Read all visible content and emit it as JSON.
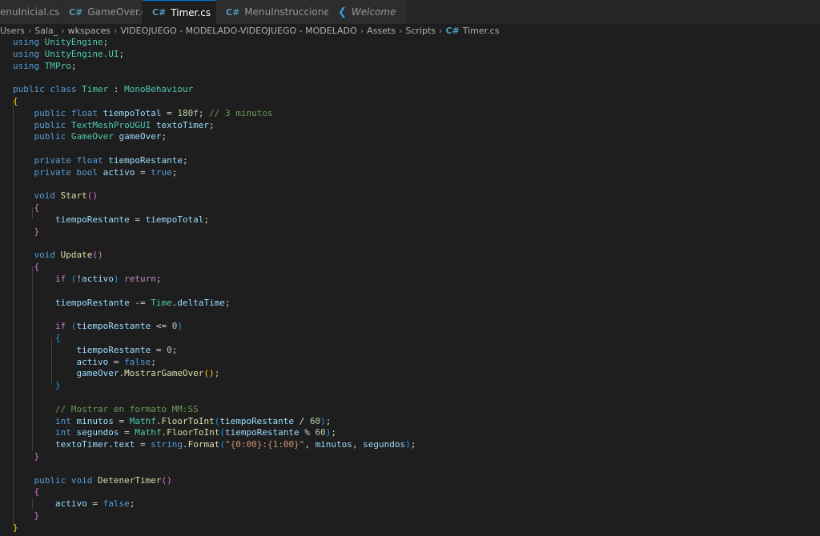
{
  "tabs": [
    {
      "label": "enuInicial.cs",
      "icon": "csharp-icon",
      "active": false
    },
    {
      "label": "GameOver.cs",
      "icon": "csharp-icon",
      "active": false
    },
    {
      "label": "Timer.cs",
      "icon": "csharp-icon",
      "active": true,
      "modified": true
    },
    {
      "label": "MenuInstrucciones.cs",
      "icon": "csharp-icon",
      "active": false
    },
    {
      "label": "Welcome",
      "icon": "vscode-icon",
      "active": false
    }
  ],
  "breadcrumb": [
    "Users",
    "Sala_",
    "wkspaces",
    "VIDEOJUEGO - MODELADO-VIDEOJUEGO - MODELADO",
    "Assets",
    "Scripts",
    "Timer.cs"
  ],
  "code": [
    [
      {
        "t": "using ",
        "c": "kw"
      },
      {
        "t": "UnityEngine",
        "c": "type"
      },
      {
        "t": ";"
      }
    ],
    [
      {
        "t": "using ",
        "c": "kw"
      },
      {
        "t": "UnityEngine.UI",
        "c": "type"
      },
      {
        "t": ";"
      }
    ],
    [
      {
        "t": "using ",
        "c": "kw"
      },
      {
        "t": "TMPro",
        "c": "type"
      },
      {
        "t": ";"
      }
    ],
    [],
    [
      {
        "t": "public ",
        "c": "kw"
      },
      {
        "t": "class ",
        "c": "kw"
      },
      {
        "t": "Timer",
        "c": "type"
      },
      {
        "t": " : "
      },
      {
        "t": "MonoBehaviour",
        "c": "type"
      }
    ],
    [
      {
        "t": "{",
        "c": "br1"
      }
    ],
    [
      {
        "t": "    "
      },
      {
        "t": "public ",
        "c": "kw"
      },
      {
        "t": "float ",
        "c": "kw"
      },
      {
        "t": "tiempoTotal",
        "c": "var"
      },
      {
        "t": " = "
      },
      {
        "t": "180f",
        "c": "num"
      },
      {
        "t": "; "
      },
      {
        "t": "// 3 minutos",
        "c": "com"
      }
    ],
    [
      {
        "t": "    "
      },
      {
        "t": "public ",
        "c": "kw"
      },
      {
        "t": "TextMeshProUGUI",
        "c": "type"
      },
      {
        "t": " "
      },
      {
        "t": "textoTimer",
        "c": "var"
      },
      {
        "t": ";"
      }
    ],
    [
      {
        "t": "    "
      },
      {
        "t": "public ",
        "c": "kw"
      },
      {
        "t": "GameOver",
        "c": "type"
      },
      {
        "t": " "
      },
      {
        "t": "gameOver",
        "c": "var"
      },
      {
        "t": ";"
      }
    ],
    [],
    [
      {
        "t": "    "
      },
      {
        "t": "private ",
        "c": "kw"
      },
      {
        "t": "float ",
        "c": "kw"
      },
      {
        "t": "tiempoRestante",
        "c": "var"
      },
      {
        "t": ";"
      }
    ],
    [
      {
        "t": "    "
      },
      {
        "t": "private ",
        "c": "kw"
      },
      {
        "t": "bool ",
        "c": "kw"
      },
      {
        "t": "activo",
        "c": "var"
      },
      {
        "t": " = "
      },
      {
        "t": "true",
        "c": "kw"
      },
      {
        "t": ";"
      }
    ],
    [],
    [
      {
        "t": "    "
      },
      {
        "t": "void ",
        "c": "kw"
      },
      {
        "t": "Start",
        "c": "fn"
      },
      {
        "t": "()",
        "c": "br2"
      }
    ],
    [
      {
        "t": "    "
      },
      {
        "t": "{",
        "c": "br2"
      }
    ],
    [
      {
        "t": "        "
      },
      {
        "t": "tiempoRestante",
        "c": "var"
      },
      {
        "t": " = "
      },
      {
        "t": "tiempoTotal",
        "c": "var"
      },
      {
        "t": ";"
      }
    ],
    [
      {
        "t": "    "
      },
      {
        "t": "}",
        "c": "br2"
      }
    ],
    [],
    [
      {
        "t": "    "
      },
      {
        "t": "void ",
        "c": "kw"
      },
      {
        "t": "Update",
        "c": "fn"
      },
      {
        "t": "()",
        "c": "br2"
      }
    ],
    [
      {
        "t": "    "
      },
      {
        "t": "{",
        "c": "br2"
      }
    ],
    [
      {
        "t": "        "
      },
      {
        "t": "if ",
        "c": "ctrl"
      },
      {
        "t": "(",
        "c": "br3"
      },
      {
        "t": "!"
      },
      {
        "t": "activo",
        "c": "var"
      },
      {
        "t": ")",
        "c": "br3"
      },
      {
        "t": " "
      },
      {
        "t": "return",
        "c": "ctrl"
      },
      {
        "t": ";"
      }
    ],
    [],
    [
      {
        "t": "        "
      },
      {
        "t": "tiempoRestante",
        "c": "var"
      },
      {
        "t": " -= "
      },
      {
        "t": "Time",
        "c": "type"
      },
      {
        "t": "."
      },
      {
        "t": "deltaTime",
        "c": "var"
      },
      {
        "t": ";"
      }
    ],
    [],
    [
      {
        "t": "        "
      },
      {
        "t": "if ",
        "c": "ctrl"
      },
      {
        "t": "(",
        "c": "br3"
      },
      {
        "t": "tiempoRestante",
        "c": "var"
      },
      {
        "t": " <= "
      },
      {
        "t": "0",
        "c": "num"
      },
      {
        "t": ")",
        "c": "br3"
      }
    ],
    [
      {
        "t": "        "
      },
      {
        "t": "{",
        "c": "br3"
      }
    ],
    [
      {
        "t": "            "
      },
      {
        "t": "tiempoRestante",
        "c": "var"
      },
      {
        "t": " = "
      },
      {
        "t": "0",
        "c": "num"
      },
      {
        "t": ";"
      }
    ],
    [
      {
        "t": "            "
      },
      {
        "t": "activo",
        "c": "var"
      },
      {
        "t": " = "
      },
      {
        "t": "false",
        "c": "kw"
      },
      {
        "t": ";"
      }
    ],
    [
      {
        "t": "            "
      },
      {
        "t": "gameOver",
        "c": "var"
      },
      {
        "t": "."
      },
      {
        "t": "MostrarGameOver",
        "c": "fn"
      },
      {
        "t": "()",
        "c": "br1"
      },
      {
        "t": ";"
      }
    ],
    [
      {
        "t": "        "
      },
      {
        "t": "}",
        "c": "br3"
      }
    ],
    [],
    [
      {
        "t": "        "
      },
      {
        "t": "// Mostrar en formato MM:SS",
        "c": "com"
      }
    ],
    [
      {
        "t": "        "
      },
      {
        "t": "int ",
        "c": "kw"
      },
      {
        "t": "minutos",
        "c": "var"
      },
      {
        "t": " = "
      },
      {
        "t": "Mathf",
        "c": "type"
      },
      {
        "t": "."
      },
      {
        "t": "FloorToInt",
        "c": "fn"
      },
      {
        "t": "(",
        "c": "br3"
      },
      {
        "t": "tiempoRestante",
        "c": "var"
      },
      {
        "t": " / "
      },
      {
        "t": "60",
        "c": "num"
      },
      {
        "t": ")",
        "c": "br3"
      },
      {
        "t": ";"
      }
    ],
    [
      {
        "t": "        "
      },
      {
        "t": "int ",
        "c": "kw"
      },
      {
        "t": "segundos",
        "c": "var"
      },
      {
        "t": " = "
      },
      {
        "t": "Mathf",
        "c": "type"
      },
      {
        "t": "."
      },
      {
        "t": "FloorToInt",
        "c": "fn"
      },
      {
        "t": "(",
        "c": "br3"
      },
      {
        "t": "tiempoRestante",
        "c": "var"
      },
      {
        "t": " % "
      },
      {
        "t": "60",
        "c": "num"
      },
      {
        "t": ")",
        "c": "br3"
      },
      {
        "t": ";"
      }
    ],
    [
      {
        "t": "        "
      },
      {
        "t": "textoTimer",
        "c": "var"
      },
      {
        "t": "."
      },
      {
        "t": "text",
        "c": "var"
      },
      {
        "t": " = "
      },
      {
        "t": "string",
        "c": "kw"
      },
      {
        "t": "."
      },
      {
        "t": "Format",
        "c": "fn"
      },
      {
        "t": "(",
        "c": "br3"
      },
      {
        "t": "\"{0:00}:{1:00}\"",
        "c": "str"
      },
      {
        "t": ", "
      },
      {
        "t": "minutos",
        "c": "var"
      },
      {
        "t": ", "
      },
      {
        "t": "segundos",
        "c": "var"
      },
      {
        "t": ")",
        "c": "br3"
      },
      {
        "t": ";"
      }
    ],
    [
      {
        "t": "    "
      },
      {
        "t": "}",
        "c": "br2"
      }
    ],
    [],
    [
      {
        "t": "    "
      },
      {
        "t": "public ",
        "c": "kw"
      },
      {
        "t": "void ",
        "c": "kw"
      },
      {
        "t": "DetenerTimer",
        "c": "fn"
      },
      {
        "t": "()",
        "c": "br2"
      }
    ],
    [
      {
        "t": "    "
      },
      {
        "t": "{",
        "c": "br2"
      }
    ],
    [
      {
        "t": "        "
      },
      {
        "t": "activo",
        "c": "var"
      },
      {
        "t": " = "
      },
      {
        "t": "false",
        "c": "kw"
      },
      {
        "t": ";"
      }
    ],
    [
      {
        "t": "    "
      },
      {
        "t": "}",
        "c": "br2"
      }
    ],
    [
      {
        "t": "}",
        "c": "br1"
      }
    ]
  ]
}
